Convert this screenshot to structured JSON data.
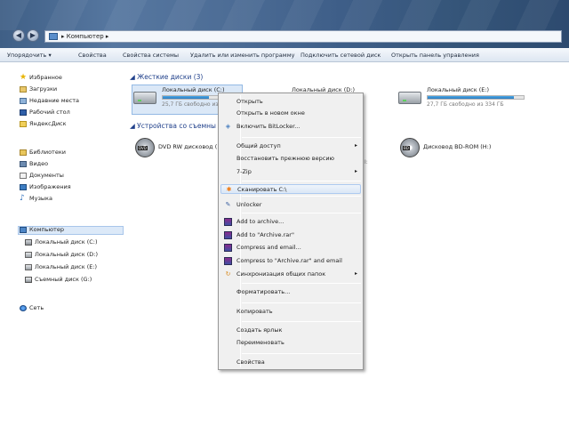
{
  "window": {
    "breadcrumb": "▸ Компьютер ▸"
  },
  "toolbar": {
    "items": [
      "Упорядочить ▾",
      "Свойства",
      "Свойства системы",
      "Удалить или изменить программу",
      "Подключить сетевой диск",
      "Открыть панель управления"
    ]
  },
  "nav": {
    "favorites": [
      "Избранное",
      "Загрузки",
      "Недавние места",
      "Рабочий стол",
      "ЯндексДиск"
    ],
    "libraries": [
      "Библиотеки",
      "Видео",
      "Документы",
      "Изображения",
      "Музыка"
    ],
    "computer": [
      "Компьютер",
      "Локальный диск (C:)",
      "Локальный диск (D:)",
      "Локальный диск (E:)",
      "Съемный диск (G:)"
    ],
    "network": "Сеть"
  },
  "main": {
    "hdd_header": "◢ Жесткие диски (3)",
    "devices_header": "◢ Устройства со съемны",
    "drives": [
      {
        "name": "Локальный диск (C:)",
        "free": "25,7 ГБ свободно из",
        "fill": 0.55
      },
      {
        "name": "Локальный диск (D:)",
        "free": "",
        "fill": 0.35
      },
      {
        "name": "Локальный диск (E:)",
        "free": "27,7 ГБ свободно из 334 ГБ",
        "fill": 0.9
      }
    ],
    "dvd": {
      "name": "DVD RW дисковод (",
      "badge": "DVD"
    },
    "bd": {
      "name": "Дисковод BD-ROM (H:)",
      "badge": "BD"
    },
    "partial_text": "I:"
  },
  "context_menu": {
    "items": [
      {
        "label": "Открыть",
        "icon": "",
        "arrow": false
      },
      {
        "label": "Открыть в новом окне",
        "icon": "",
        "arrow": false
      },
      {
        "label": "Включить BitLocker...",
        "icon": "shield-icon",
        "arrow": false
      },
      {
        "label": "Общий доступ",
        "icon": "",
        "arrow": true
      },
      {
        "label": "Восстановить прежнюю версию",
        "icon": "",
        "arrow": false
      },
      {
        "label": "7-Zip",
        "icon": "",
        "arrow": true
      },
      {
        "label": "Сканировать C:\\",
        "icon": "avast-icon",
        "arrow": false
      },
      {
        "label": "Unlocker",
        "icon": "unlocker-icon",
        "arrow": false
      },
      {
        "label": "Add to archive...",
        "icon": "winrar-icon",
        "arrow": false
      },
      {
        "label": "Add to \"Archive.rar\"",
        "icon": "winrar-icon",
        "arrow": false
      },
      {
        "label": "Compress and email...",
        "icon": "winrar-icon",
        "arrow": false
      },
      {
        "label": "Compress to \"Archive.rar\" and email",
        "icon": "winrar-icon",
        "arrow": false
      },
      {
        "label": "Синхронизация общих папок",
        "icon": "sync-icon",
        "arrow": true
      },
      {
        "label": "Форматировать...",
        "icon": "",
        "arrow": false
      },
      {
        "label": "Копировать",
        "icon": "",
        "arrow": false
      },
      {
        "label": "Создать ярлык",
        "icon": "",
        "arrow": false
      },
      {
        "label": "Переименовать",
        "icon": "",
        "arrow": false
      },
      {
        "label": "Свойства",
        "icon": "",
        "arrow": false
      }
    ],
    "highlighted_index": 6
  },
  "colors": {
    "accent": "#2a7bc0",
    "selection": "#dbe8f7",
    "header_text": "#1f3f8a"
  }
}
